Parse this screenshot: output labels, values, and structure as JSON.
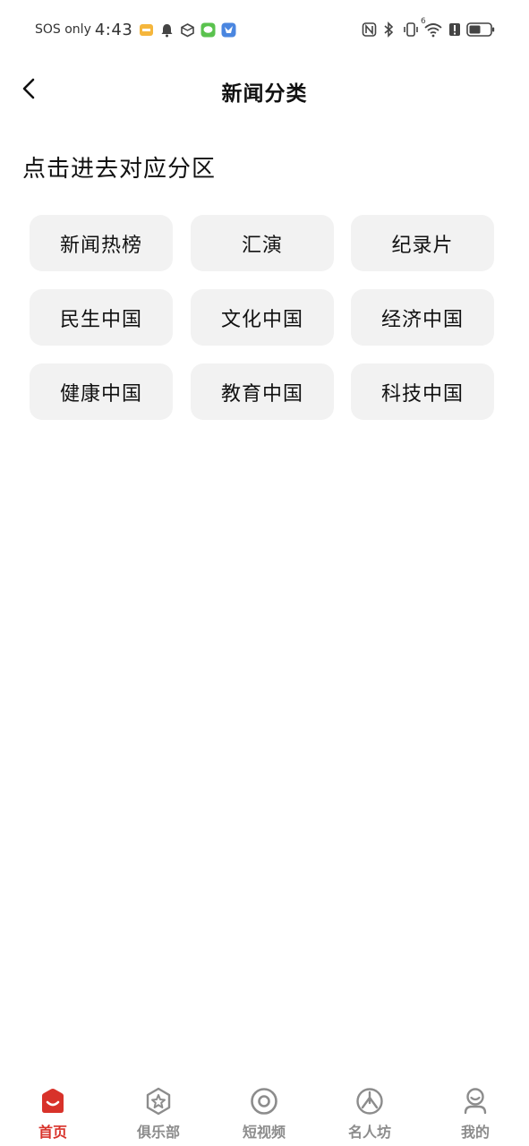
{
  "status_bar": {
    "carrier": "SOS only",
    "time": "4:43",
    "signal_label": "6"
  },
  "header": {
    "title": "新闻分类"
  },
  "hint": "点击进去对应分区",
  "categories": [
    "新闻热榜",
    "汇演",
    "纪录片",
    "民生中国",
    "文化中国",
    "经济中国",
    "健康中国",
    "教育中国",
    "科技中国"
  ],
  "bottom_nav": {
    "items": [
      {
        "label": "首页",
        "icon": "home-icon"
      },
      {
        "label": "俱乐部",
        "icon": "club-icon"
      },
      {
        "label": "短视频",
        "icon": "video-icon"
      },
      {
        "label": "名人坊",
        "icon": "celebrity-icon"
      },
      {
        "label": "我的",
        "icon": "profile-icon"
      }
    ],
    "active_index": 0
  },
  "colors": {
    "accent": "#d8322a",
    "inactive": "#8c8c8c",
    "tile_bg": "#f2f2f2"
  }
}
